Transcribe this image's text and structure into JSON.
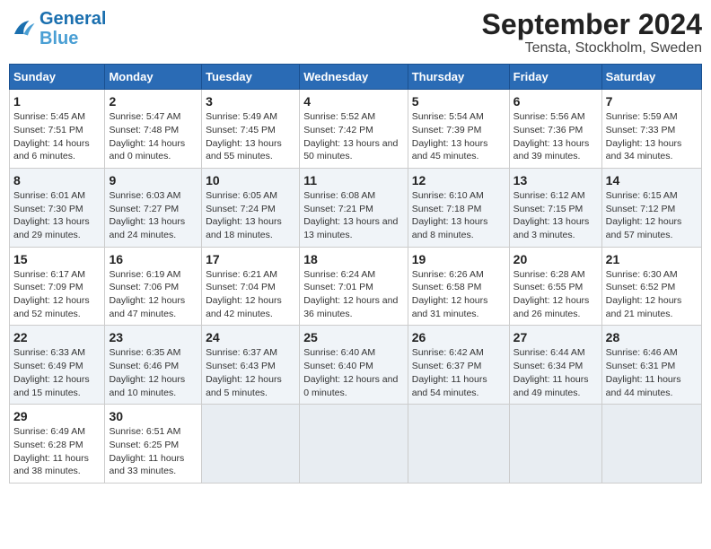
{
  "header": {
    "logo_line1": "General",
    "logo_line2": "Blue",
    "main_title": "September 2024",
    "sub_title": "Tensta, Stockholm, Sweden"
  },
  "columns": [
    "Sunday",
    "Monday",
    "Tuesday",
    "Wednesday",
    "Thursday",
    "Friday",
    "Saturday"
  ],
  "weeks": [
    [
      {
        "day": "1",
        "sunrise": "Sunrise: 5:45 AM",
        "sunset": "Sunset: 7:51 PM",
        "daylight": "Daylight: 14 hours and 6 minutes."
      },
      {
        "day": "2",
        "sunrise": "Sunrise: 5:47 AM",
        "sunset": "Sunset: 7:48 PM",
        "daylight": "Daylight: 14 hours and 0 minutes."
      },
      {
        "day": "3",
        "sunrise": "Sunrise: 5:49 AM",
        "sunset": "Sunset: 7:45 PM",
        "daylight": "Daylight: 13 hours and 55 minutes."
      },
      {
        "day": "4",
        "sunrise": "Sunrise: 5:52 AM",
        "sunset": "Sunset: 7:42 PM",
        "daylight": "Daylight: 13 hours and 50 minutes."
      },
      {
        "day": "5",
        "sunrise": "Sunrise: 5:54 AM",
        "sunset": "Sunset: 7:39 PM",
        "daylight": "Daylight: 13 hours and 45 minutes."
      },
      {
        "day": "6",
        "sunrise": "Sunrise: 5:56 AM",
        "sunset": "Sunset: 7:36 PM",
        "daylight": "Daylight: 13 hours and 39 minutes."
      },
      {
        "day": "7",
        "sunrise": "Sunrise: 5:59 AM",
        "sunset": "Sunset: 7:33 PM",
        "daylight": "Daylight: 13 hours and 34 minutes."
      }
    ],
    [
      {
        "day": "8",
        "sunrise": "Sunrise: 6:01 AM",
        "sunset": "Sunset: 7:30 PM",
        "daylight": "Daylight: 13 hours and 29 minutes."
      },
      {
        "day": "9",
        "sunrise": "Sunrise: 6:03 AM",
        "sunset": "Sunset: 7:27 PM",
        "daylight": "Daylight: 13 hours and 24 minutes."
      },
      {
        "day": "10",
        "sunrise": "Sunrise: 6:05 AM",
        "sunset": "Sunset: 7:24 PM",
        "daylight": "Daylight: 13 hours and 18 minutes."
      },
      {
        "day": "11",
        "sunrise": "Sunrise: 6:08 AM",
        "sunset": "Sunset: 7:21 PM",
        "daylight": "Daylight: 13 hours and 13 minutes."
      },
      {
        "day": "12",
        "sunrise": "Sunrise: 6:10 AM",
        "sunset": "Sunset: 7:18 PM",
        "daylight": "Daylight: 13 hours and 8 minutes."
      },
      {
        "day": "13",
        "sunrise": "Sunrise: 6:12 AM",
        "sunset": "Sunset: 7:15 PM",
        "daylight": "Daylight: 13 hours and 3 minutes."
      },
      {
        "day": "14",
        "sunrise": "Sunrise: 6:15 AM",
        "sunset": "Sunset: 7:12 PM",
        "daylight": "Daylight: 12 hours and 57 minutes."
      }
    ],
    [
      {
        "day": "15",
        "sunrise": "Sunrise: 6:17 AM",
        "sunset": "Sunset: 7:09 PM",
        "daylight": "Daylight: 12 hours and 52 minutes."
      },
      {
        "day": "16",
        "sunrise": "Sunrise: 6:19 AM",
        "sunset": "Sunset: 7:06 PM",
        "daylight": "Daylight: 12 hours and 47 minutes."
      },
      {
        "day": "17",
        "sunrise": "Sunrise: 6:21 AM",
        "sunset": "Sunset: 7:04 PM",
        "daylight": "Daylight: 12 hours and 42 minutes."
      },
      {
        "day": "18",
        "sunrise": "Sunrise: 6:24 AM",
        "sunset": "Sunset: 7:01 PM",
        "daylight": "Daylight: 12 hours and 36 minutes."
      },
      {
        "day": "19",
        "sunrise": "Sunrise: 6:26 AM",
        "sunset": "Sunset: 6:58 PM",
        "daylight": "Daylight: 12 hours and 31 minutes."
      },
      {
        "day": "20",
        "sunrise": "Sunrise: 6:28 AM",
        "sunset": "Sunset: 6:55 PM",
        "daylight": "Daylight: 12 hours and 26 minutes."
      },
      {
        "day": "21",
        "sunrise": "Sunrise: 6:30 AM",
        "sunset": "Sunset: 6:52 PM",
        "daylight": "Daylight: 12 hours and 21 minutes."
      }
    ],
    [
      {
        "day": "22",
        "sunrise": "Sunrise: 6:33 AM",
        "sunset": "Sunset: 6:49 PM",
        "daylight": "Daylight: 12 hours and 15 minutes."
      },
      {
        "day": "23",
        "sunrise": "Sunrise: 6:35 AM",
        "sunset": "Sunset: 6:46 PM",
        "daylight": "Daylight: 12 hours and 10 minutes."
      },
      {
        "day": "24",
        "sunrise": "Sunrise: 6:37 AM",
        "sunset": "Sunset: 6:43 PM",
        "daylight": "Daylight: 12 hours and 5 minutes."
      },
      {
        "day": "25",
        "sunrise": "Sunrise: 6:40 AM",
        "sunset": "Sunset: 6:40 PM",
        "daylight": "Daylight: 12 hours and 0 minutes."
      },
      {
        "day": "26",
        "sunrise": "Sunrise: 6:42 AM",
        "sunset": "Sunset: 6:37 PM",
        "daylight": "Daylight: 11 hours and 54 minutes."
      },
      {
        "day": "27",
        "sunrise": "Sunrise: 6:44 AM",
        "sunset": "Sunset: 6:34 PM",
        "daylight": "Daylight: 11 hours and 49 minutes."
      },
      {
        "day": "28",
        "sunrise": "Sunrise: 6:46 AM",
        "sunset": "Sunset: 6:31 PM",
        "daylight": "Daylight: 11 hours and 44 minutes."
      }
    ],
    [
      {
        "day": "29",
        "sunrise": "Sunrise: 6:49 AM",
        "sunset": "Sunset: 6:28 PM",
        "daylight": "Daylight: 11 hours and 38 minutes."
      },
      {
        "day": "30",
        "sunrise": "Sunrise: 6:51 AM",
        "sunset": "Sunset: 6:25 PM",
        "daylight": "Daylight: 11 hours and 33 minutes."
      },
      null,
      null,
      null,
      null,
      null
    ]
  ]
}
